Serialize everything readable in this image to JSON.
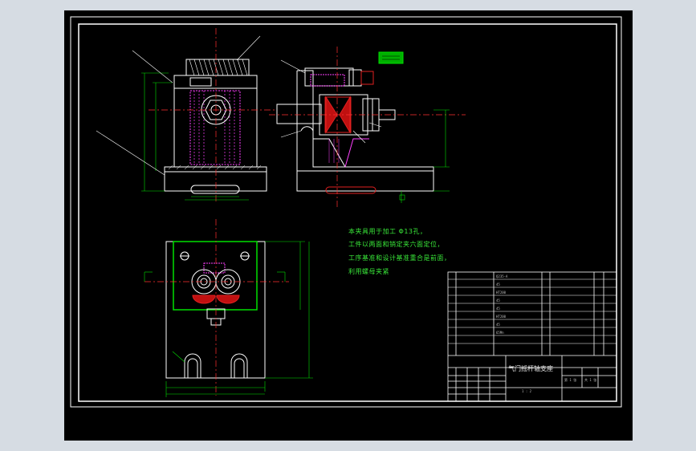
{
  "drawing": {
    "notes": [
      "本夹具用于加工 Φ13孔，",
      "工件以两面和销定夹六面定位，",
      "工序基准和设计基准重合是前面，",
      "利用螺母夹紧"
    ],
    "title_block": {
      "part_name": "气门摇杆轴支座",
      "scale": "1 : 2",
      "sheet": "第 1 张",
      "total": "共 1 张",
      "rows": [
        "Q235-A",
        "45",
        "HT200",
        "45",
        "45",
        "HT200",
        "45",
        "65Mn"
      ]
    },
    "colors": {
      "background": "#000000",
      "outline": "#ffffff",
      "dimension": "#00e000",
      "centerline": "#ff3030",
      "hatch": "#ff40ff",
      "highlight": "#e02020"
    }
  }
}
